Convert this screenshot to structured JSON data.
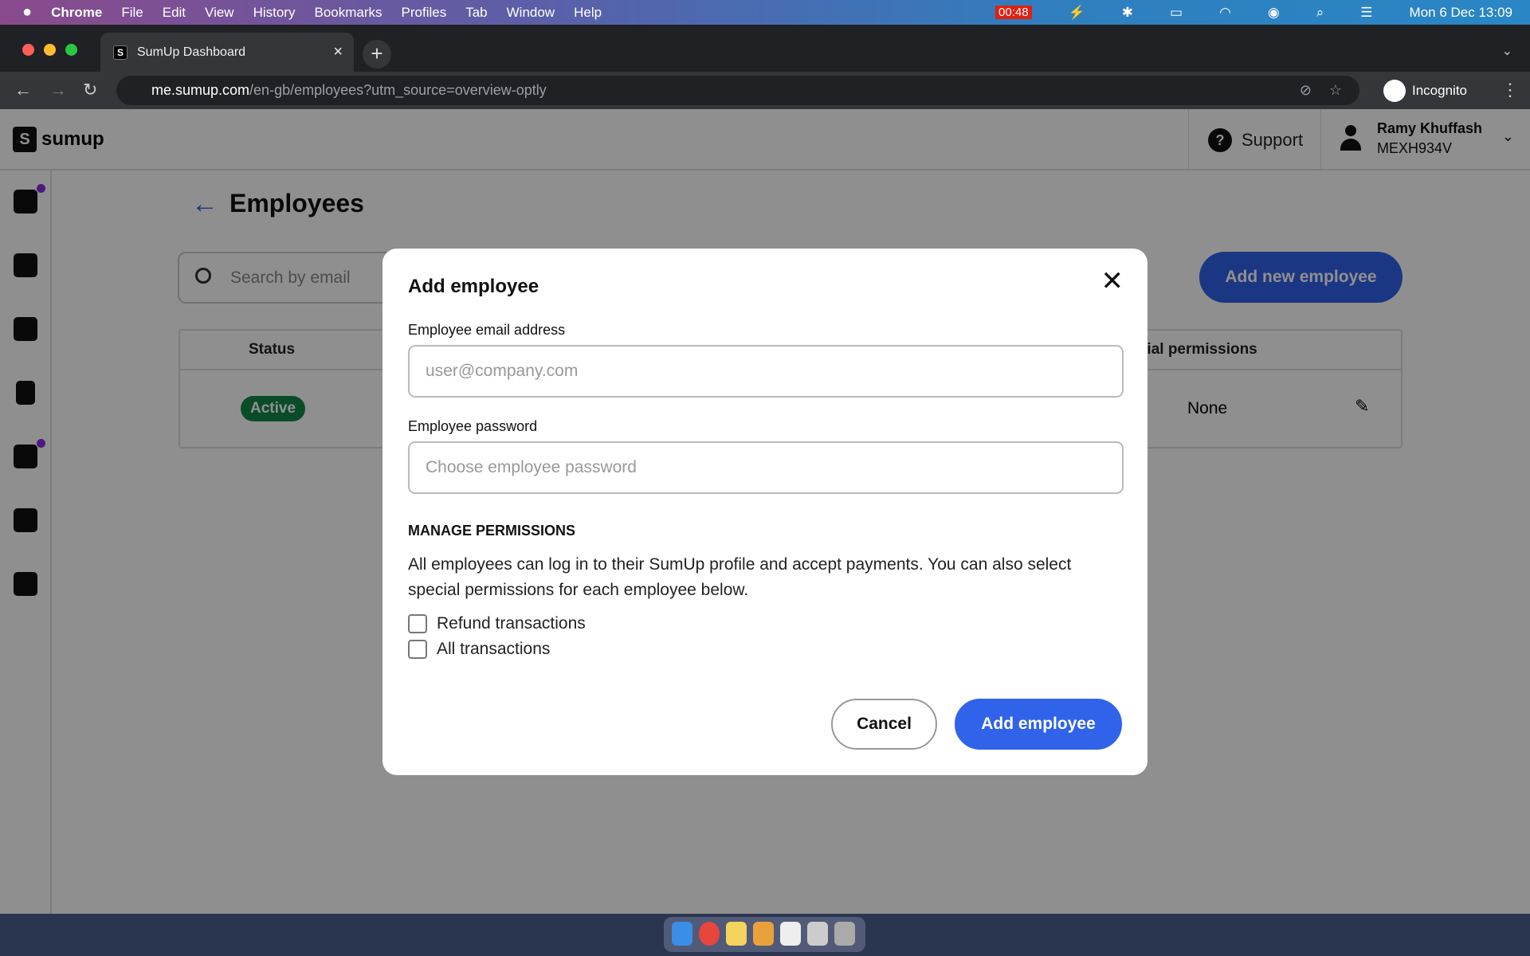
{
  "menubar": {
    "app": "Chrome",
    "items": [
      "File",
      "Edit",
      "View",
      "History",
      "Bookmarks",
      "Profiles",
      "Tab",
      "Window",
      "Help"
    ],
    "timer": "00:48",
    "datetime": "Mon 6 Dec  13:09"
  },
  "browser": {
    "tab_title": "SumUp Dashboard",
    "url_host": "me.sumup.com",
    "url_path": "/en-gb/employees?utm_source=overview-optly",
    "profile": "Incognito"
  },
  "header": {
    "logo": "sumup",
    "support": "Support",
    "user_name": "Ramy Khuffash",
    "user_id": "MEXH934V"
  },
  "sidebar": {
    "items": [
      "home-icon",
      "wallet-icon",
      "store-icon",
      "invoice-icon",
      "wallet-2-icon",
      "payment-link-icon",
      "cart-icon"
    ]
  },
  "page": {
    "title": "Employees",
    "search_placeholder": "Search by email",
    "add_new": "Add new employee",
    "columns": {
      "status": "Status",
      "permissions": "Special permissions"
    },
    "rows": [
      {
        "status": "Active",
        "permissions": "None"
      }
    ]
  },
  "modal": {
    "title": "Add employee",
    "email_label": "Employee email address",
    "email_placeholder": "user@company.com",
    "password_label": "Employee password",
    "password_placeholder": "Choose employee password",
    "section": "MANAGE PERMISSIONS",
    "description": "All employees can log in to their SumUp profile and accept payments. You can also select special permissions for each employee below.",
    "permissions": [
      {
        "label": "Refund transactions",
        "checked": false
      },
      {
        "label": "All transactions",
        "checked": false
      }
    ],
    "cancel": "Cancel",
    "submit": "Add employee"
  },
  "colors": {
    "primary": "#3063e9",
    "active_badge": "#138849"
  }
}
